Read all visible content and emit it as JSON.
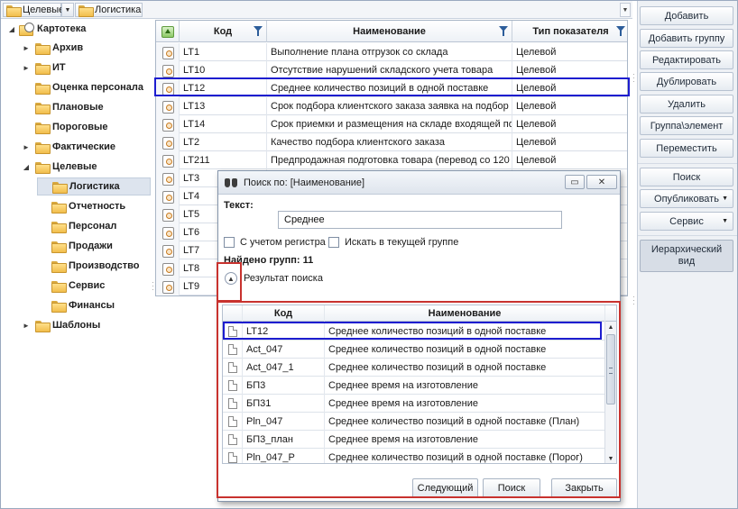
{
  "breadcrumb": {
    "items": [
      {
        "label": "Целевые"
      },
      {
        "label": "Логистика"
      }
    ]
  },
  "tree": {
    "root": "Картотека",
    "items": [
      {
        "label": "Архив",
        "expand": "►"
      },
      {
        "label": "ИТ",
        "expand": "►"
      },
      {
        "label": "Оценка персонала",
        "expand": ""
      },
      {
        "label": "Плановые",
        "expand": ""
      },
      {
        "label": "Пороговые",
        "expand": ""
      },
      {
        "label": "Фактические",
        "expand": "►"
      },
      {
        "label": "Целевые",
        "expand": "◢"
      },
      {
        "label": "Логистика",
        "expand": "",
        "selected": true
      },
      {
        "label": "Отчетность",
        "expand": ""
      },
      {
        "label": "Персонал",
        "expand": ""
      },
      {
        "label": "Продажи",
        "expand": ""
      },
      {
        "label": "Производство",
        "expand": ""
      },
      {
        "label": "Сервис",
        "expand": ""
      },
      {
        "label": "Финансы",
        "expand": ""
      },
      {
        "label": "Шаблоны",
        "expand": "►"
      }
    ]
  },
  "grid": {
    "columns": {
      "code": "Код",
      "name": "Наименование",
      "type": "Тип показателя"
    },
    "rows": [
      {
        "code": "LT1",
        "name": "Выполнение плана отгрузок со склада",
        "type": "Целевой"
      },
      {
        "code": "LT10",
        "name": "Отсутствие нарушений складского учета товара",
        "type": "Целевой"
      },
      {
        "code": "LT12",
        "name": "Среднее количество позиций в одной поставке",
        "type": "Целевой"
      },
      {
        "code": "LT13",
        "name": "Срок подбора клиентского заказа заявка на подбор",
        "type": "Целевой"
      },
      {
        "code": "LT14",
        "name": "Срок приемки и размещения на складе входящей пос",
        "type": "Целевой"
      },
      {
        "code": "LT2",
        "name": "Качество подбора клиентского заказа",
        "type": "Целевой"
      },
      {
        "code": "LT211",
        "name": "Предпродажная подготовка товара (перевод со 120",
        "type": "Целевой"
      },
      {
        "code": "LT3",
        "name": "",
        "type": ""
      },
      {
        "code": "LT4",
        "name": "",
        "type": ""
      },
      {
        "code": "LT5",
        "name": "",
        "type": ""
      },
      {
        "code": "LT6",
        "name": "",
        "type": ""
      },
      {
        "code": "LT7",
        "name": "",
        "type": ""
      },
      {
        "code": "LT8",
        "name": "",
        "type": ""
      },
      {
        "code": "LT9",
        "name": "",
        "type": ""
      }
    ]
  },
  "toolbar": {
    "add": "Добавить",
    "add_group": "Добавить группу",
    "edit": "Редактировать",
    "duplicate": "Дублировать",
    "delete": "Удалить",
    "group_element": "Группа\\элемент",
    "move": "Переместить",
    "search": "Поиск",
    "publish": "Опубликовать",
    "service": "Сервис",
    "hierarchy_line1": "Иерархический",
    "hierarchy_line2": "вид"
  },
  "dialog": {
    "title": "Поиск по: [Наименование]",
    "text_label": "Текст:",
    "text_value": "Среднее",
    "case_label": "С учетом регистра",
    "group_label": "Искать в текущей группе",
    "found": "Найдено групп: 11",
    "result_label": "Результат поиска",
    "columns": {
      "code": "Код",
      "name": "Наименование"
    },
    "rows": [
      {
        "code": "LT12",
        "name": "Среднее количество позиций в одной поставке"
      },
      {
        "code": "Act_047",
        "name": "Среднее количество позиций в одной поставке"
      },
      {
        "code": "Act_047_1",
        "name": "Среднее количество позиций в одной поставке"
      },
      {
        "code": "БП3",
        "name": "Среднее время на изготовление"
      },
      {
        "code": "БП31",
        "name": "Среднее время на изготовление"
      },
      {
        "code": "Pln_047",
        "name": "Среднее количество позиций в одной поставке (План)"
      },
      {
        "code": "БП3_план",
        "name": "Среднее время на изготовление"
      },
      {
        "code": "Pln_047_P",
        "name": "Среднее количество позиций в одной поставке (Порог)"
      }
    ],
    "next_button": "Следующий",
    "search_button": "Поиск",
    "close_button": "Закрыть"
  },
  "colors": {
    "highlight": "#1d1dcf",
    "annotation": "#c8322e"
  }
}
